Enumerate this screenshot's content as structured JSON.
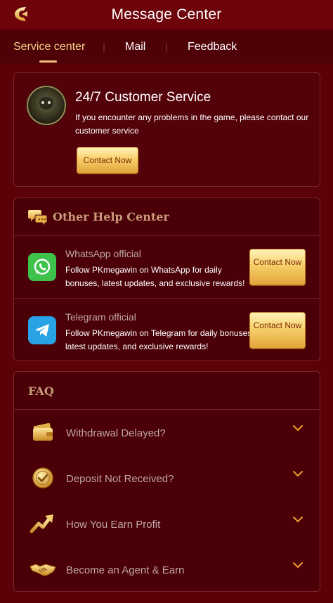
{
  "header": {
    "title": "Message Center",
    "back_icon": "back-arrow-icon"
  },
  "tabs": [
    {
      "label": "Service center",
      "active": true
    },
    {
      "label": "Mail",
      "active": false
    },
    {
      "label": "Feedback",
      "active": false
    }
  ],
  "service": {
    "avatar_icon": "customer-service-robot-avatar",
    "title": "24/7 Customer Service",
    "description": "If you encounter any problems in the game, please contact our customer service",
    "contact_label": "Contact Now"
  },
  "help": {
    "section_icon": "chat-bubbles-icon",
    "section_title": "Other Help Center",
    "items": [
      {
        "icon": "whatsapp-icon",
        "name": "WhatsApp official",
        "description": "Follow PKmegawin on WhatsApp for daily bonuses, latest updates, and exclusive rewards!",
        "button_label": "Contact Now"
      },
      {
        "icon": "telegram-icon",
        "name": "Telegram official",
        "description": "Follow PKmegawin on Telegram for daily bonuses, latest updates, and exclusive rewards!",
        "button_label": "Contact Now"
      }
    ]
  },
  "faq": {
    "title": "FAQ",
    "items": [
      {
        "icon": "wallet-icon",
        "label": "Withdrawal Delayed?"
      },
      {
        "icon": "gold-coin-check-icon",
        "label": "Deposit Not Received?"
      },
      {
        "icon": "growth-arrow-icon",
        "label": "How You Earn Profit"
      },
      {
        "icon": "handshake-icon",
        "label": "Become an Agent & Earn"
      }
    ]
  },
  "colors": {
    "background": "#5a0208",
    "accent_gold": "#f7d58a",
    "whatsapp": "#3ec24b",
    "telegram": "#2aa3e6"
  }
}
